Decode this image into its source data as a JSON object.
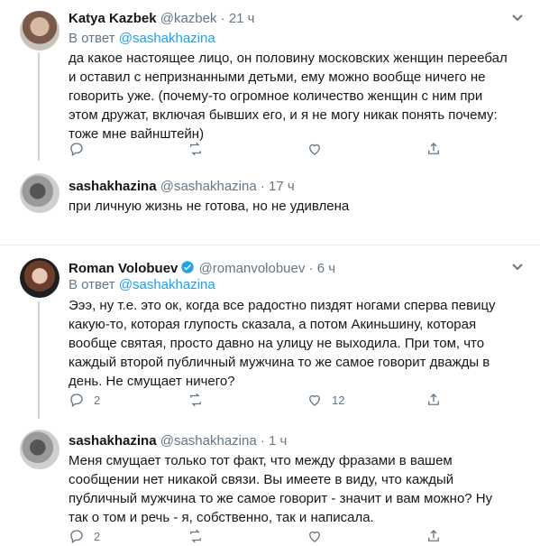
{
  "tweets": [
    {
      "name": "Katya Kazbek",
      "handle": "@kazbek",
      "dot": "·",
      "time": "21 ч",
      "reply_prefix": "В ответ",
      "reply_handle": "@sashakhazina",
      "lines": [
        "да какое настоящее лицо, он половину московских женщин переебал",
        "и оставил с непризнанными детьми, ему можно вообще ничего не",
        "говорить уже. (почему-то огромное количество  женщин с ним при",
        "этом дружат, включая бывших его, и я не могу никак понять почему:",
        "тоже мне вайнштейн)"
      ],
      "reply_count": "",
      "retweet_count": "",
      "like_count": ""
    },
    {
      "name": "sashakhazina",
      "handle": "@sashakhazina",
      "dot": "·",
      "time": "17 ч",
      "lines": [
        "при личную жизнь не готова, но не удивлена"
      ],
      "reply_count": "",
      "retweet_count": "",
      "like_count": ""
    },
    {
      "name": "Roman Volobuev",
      "handle": "@romanvolobuev",
      "dot": "·",
      "time": "6 ч",
      "verified": true,
      "reply_prefix": "В ответ",
      "reply_handle": "@sashakhazina",
      "lines": [
        "Эээ, ну т.е. это ок, когда все радостно пиздят ногами сперва певицу",
        "какую-то, которая глупость сказала, а потом Акиньшину, которая",
        "вообще святая, просто давно на улицу не выходила. При том, что",
        "каждый второй публичный мужчина то же самое говорит дважды в",
        "день. Не смущает ничего?"
      ],
      "reply_count": "2",
      "retweet_count": "",
      "like_count": "12"
    },
    {
      "name": "sashakhazina",
      "handle": "@sashakhazina",
      "dot": "·",
      "time": "1 ч",
      "lines": [
        "Меня смущает только тот факт, что между фразами в вашем",
        "сообщении нет никакой связи. Вы имеете в виду, что каждый",
        "публичный мужчина то же самое говорит - значит и вам можно? Ну",
        "так о том и речь - я, собственно, так и написала."
      ],
      "reply_count": "2",
      "retweet_count": "",
      "like_count": ""
    }
  ],
  "colors": {
    "accent": "#1da1f2",
    "muted": "#657786",
    "text": "#14171a",
    "verified": "#1da1f2"
  },
  "icons": [
    "reply-icon",
    "retweet-icon",
    "like-icon",
    "share-icon",
    "caret-down-icon",
    "verified-badge-icon"
  ]
}
